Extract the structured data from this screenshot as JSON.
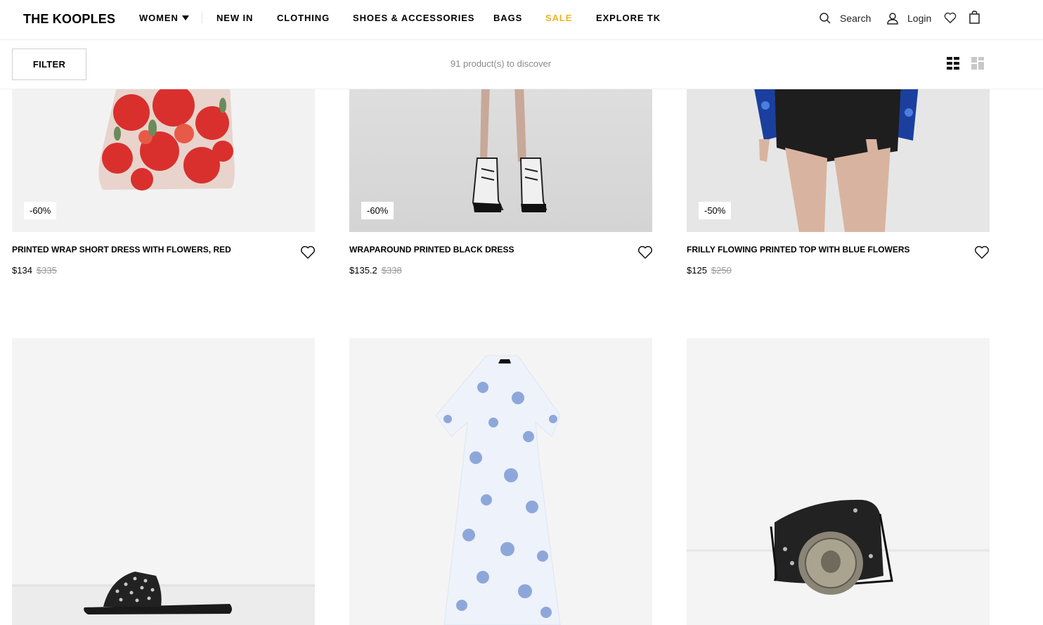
{
  "brand": {
    "logo": "THE KOOPLES"
  },
  "nav": {
    "items": [
      {
        "label": "WOMEN",
        "has_caret": true
      },
      {
        "label": "NEW IN"
      },
      {
        "label": "CLOTHING"
      },
      {
        "label": "SHOES & ACCESSORIES"
      },
      {
        "label": "BAGS"
      },
      {
        "label": "SALE",
        "color": "#f0b323"
      },
      {
        "label": "EXPLORE TK"
      }
    ]
  },
  "header": {
    "search_label": "Search",
    "login_label": "Login",
    "icons": [
      "search-icon",
      "user-icon",
      "heart-icon",
      "bag-icon"
    ]
  },
  "filterbar": {
    "filter_label": "FILTER",
    "count_text": "91 product(s) to discover",
    "view_icons": [
      "grid-small-view-icon",
      "grid-large-view-icon"
    ]
  },
  "products": [
    {
      "name": "PRINTED WRAP SHORT DRESS WITH FLOWERS, RED",
      "price": "$134",
      "old_price": "$335",
      "discount": "-60%",
      "image": "red-floral-dress"
    },
    {
      "name": "WRAPAROUND PRINTED BLACK DRESS",
      "price": "$135.2",
      "old_price": "$338",
      "discount": "-60%",
      "image": "white-combat-boots-legs"
    },
    {
      "name": "FRILLY FLOWING PRINTED TOP WITH BLUE FLOWERS",
      "price": "$125",
      "old_price": "$250",
      "discount": "-50%",
      "image": "blue-top-denim-shorts"
    },
    {
      "name": "",
      "price": "",
      "old_price": "",
      "discount": "",
      "image": "studded-black-sandal"
    },
    {
      "name": "",
      "price": "",
      "old_price": "",
      "discount": "",
      "image": "blue-floral-maxi-dress"
    },
    {
      "name": "",
      "price": "",
      "old_price": "",
      "discount": "",
      "image": "black-belt-silver-buckle"
    }
  ],
  "colors": {
    "accent_sale": "#f0b323",
    "image_bg": "#f4f4f4",
    "muted_text": "#8a8a8a"
  }
}
